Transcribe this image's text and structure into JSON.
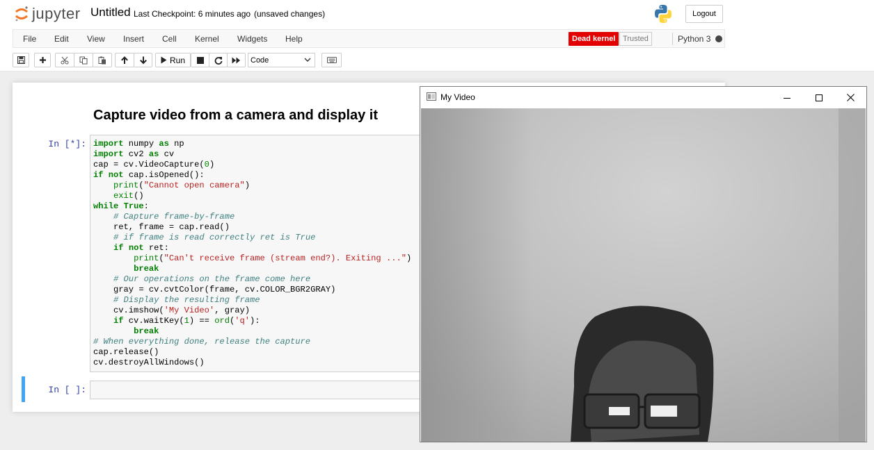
{
  "header": {
    "logo_text": "jupyter",
    "notebook_name": "Untitled",
    "checkpoint": "Last Checkpoint: 6 minutes ago",
    "autosave_status": "(unsaved changes)",
    "logout_label": "Logout"
  },
  "menubar": {
    "items": [
      "File",
      "Edit",
      "View",
      "Insert",
      "Cell",
      "Kernel",
      "Widgets",
      "Help"
    ],
    "kernel_status": "Dead kernel",
    "trusted": "Trusted",
    "kernel_name": "Python 3"
  },
  "toolbar": {
    "run_label": "Run",
    "cell_type": "Code",
    "icons": [
      "save-icon",
      "plus-icon",
      "cut-icon",
      "copy-icon",
      "paste-icon",
      "arrow-up-icon",
      "arrow-down-icon",
      "play-icon",
      "stop-icon",
      "restart-icon",
      "fast-forward-icon",
      "keyboard-icon"
    ]
  },
  "notebook": {
    "markdown_heading": "Capture video from a camera and display it",
    "cells": [
      {
        "prompt": "In [*]:",
        "code": [
          "import numpy as np",
          "import cv2 as cv",
          "cap = cv.VideoCapture(0)",
          "if not cap.isOpened():",
          "    print(\"Cannot open camera\")",
          "    exit()",
          "while True:",
          "    # Capture frame-by-frame",
          "    ret, frame = cap.read()",
          "    # if frame is read correctly ret is True",
          "    if not ret:",
          "        print(\"Can't receive frame (stream end?). Exiting ...\")",
          "        break",
          "    # Our operations on the frame come here",
          "    gray = cv.cvtColor(frame, cv.COLOR_BGR2GRAY)",
          "    # Display the resulting frame",
          "    cv.imshow('My Video', gray)",
          "    if cv.waitKey(1) == ord('q'):",
          "        break",
          "# When everything done, release the capture",
          "cap.release()",
          "cv.destroyAllWindows()"
        ]
      },
      {
        "prompt": "In [ ]:",
        "code": []
      }
    ]
  },
  "video_window": {
    "title": "My Video",
    "controls": [
      "minimize-icon",
      "maximize-icon",
      "close-icon"
    ]
  }
}
